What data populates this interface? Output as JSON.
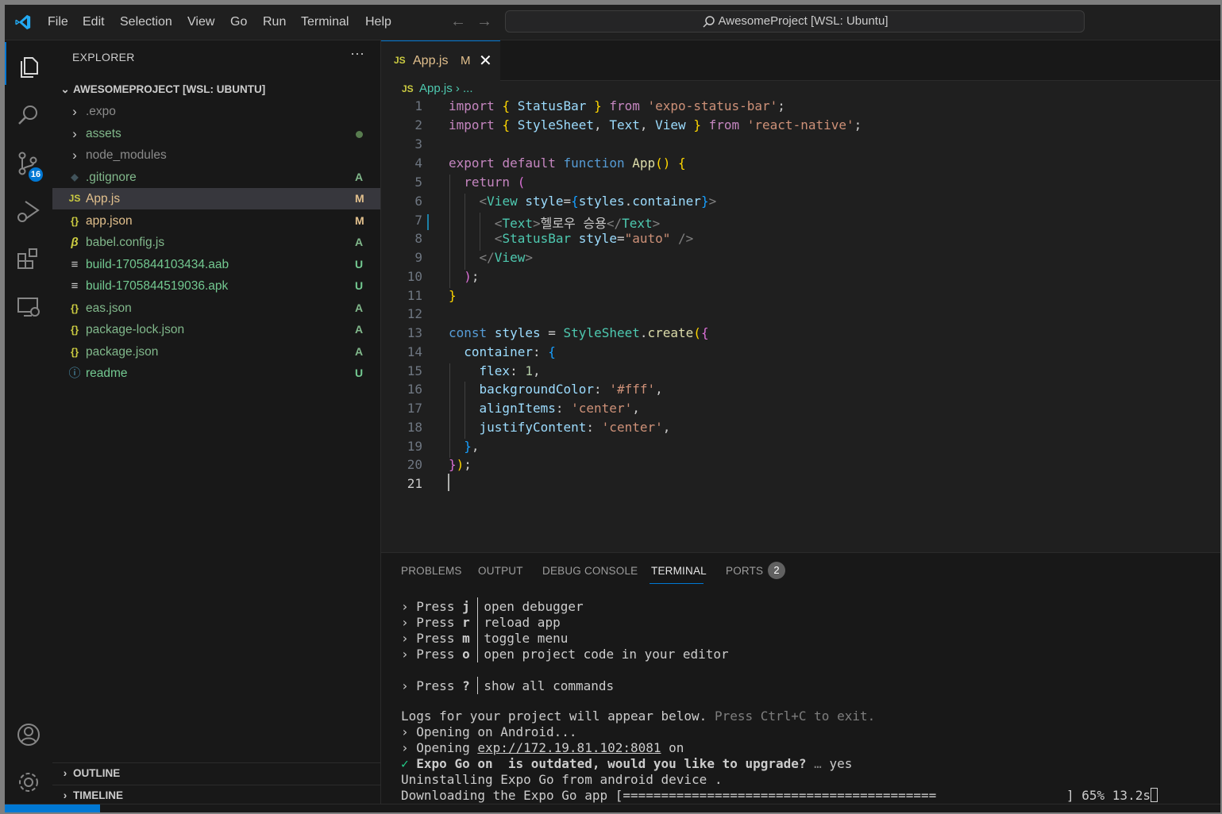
{
  "menu": [
    "File",
    "Edit",
    "Selection",
    "View",
    "Go",
    "Run",
    "Terminal",
    "Help"
  ],
  "search": {
    "text": "AwesomeProject [WSL: Ubuntu]"
  },
  "activity": {
    "scm_badge": "16"
  },
  "explorer": {
    "title": "EXPLORER",
    "more": "···",
    "project": "AWESOMEPROJECT [WSL: UBUNTU]",
    "items": [
      {
        "label": ".expo",
        "icon": "›",
        "status": ""
      },
      {
        "label": "assets",
        "icon": "›",
        "status": ""
      },
      {
        "label": "node_modules",
        "icon": "›",
        "status": ""
      },
      {
        "label": ".gitignore",
        "icon": "◆",
        "status": "A"
      },
      {
        "label": "App.js",
        "icon": "JS",
        "status": "M"
      },
      {
        "label": "app.json",
        "icon": "{}",
        "status": "M"
      },
      {
        "label": "babel.config.js",
        "icon": "β",
        "status": "A"
      },
      {
        "label": "build-1705844103434.aab",
        "icon": "≡",
        "status": "U"
      },
      {
        "label": "build-1705844519036.apk",
        "icon": "≡",
        "status": "U"
      },
      {
        "label": "eas.json",
        "icon": "{}",
        "status": "A"
      },
      {
        "label": "package-lock.json",
        "icon": "{}",
        "status": "A"
      },
      {
        "label": "package.json",
        "icon": "{}",
        "status": "A"
      },
      {
        "label": "readme",
        "icon": "ⓘ",
        "status": "U"
      }
    ],
    "outline": "OUTLINE",
    "timeline": "TIMELINE"
  },
  "editor": {
    "tab": {
      "icon": "JS",
      "name": "App.js",
      "status": "M",
      "close": "✕"
    },
    "breadcrumb": {
      "icon": "JS",
      "text": "App.js › ..."
    },
    "line_numbers": [
      "1",
      "2",
      "3",
      "4",
      "5",
      "6",
      "7",
      "8",
      "9",
      "10",
      "11",
      "12",
      "13",
      "14",
      "15",
      "16",
      "17",
      "18",
      "19",
      "20",
      "21"
    ],
    "code": {
      "l1": [
        "import",
        "{",
        "StatusBar",
        "}",
        "from",
        "'expo-status-bar'",
        ";"
      ],
      "l2": [
        "import",
        "{",
        "StyleSheet",
        ",",
        "Text",
        ",",
        "View",
        "}",
        "from",
        "'react-native'",
        ";"
      ],
      "l4": [
        "export",
        "default",
        "function",
        "App",
        "()",
        "{"
      ],
      "l5": [
        "return",
        "("
      ],
      "l6": [
        "<",
        "View",
        "style",
        "=",
        "{",
        "styles",
        ".",
        "container",
        "}",
        ">"
      ],
      "l7": [
        "<",
        "Text",
        ">",
        "헬로우 승용",
        "</",
        "Text",
        ">"
      ],
      "l8": [
        "<",
        "StatusBar",
        "style",
        "=",
        "\"auto\"",
        "/>"
      ],
      "l9": [
        "</",
        "View",
        ">"
      ],
      "l10": [
        ")",
        ";"
      ],
      "l11": [
        "}"
      ],
      "l13": [
        "const",
        "styles",
        "=",
        "StyleSheet",
        ".",
        "create",
        "(",
        "{"
      ],
      "l14": [
        "container",
        ":",
        "{"
      ],
      "l15": [
        "flex",
        ":",
        "1",
        ","
      ],
      "l16": [
        "backgroundColor",
        ":",
        "'#fff'",
        ","
      ],
      "l17": [
        "alignItems",
        ":",
        "'center'",
        ","
      ],
      "l18": [
        "justifyContent",
        ":",
        "'center'",
        ","
      ],
      "l19": [
        "}",
        ","
      ],
      "l20": [
        "}",
        ")",
        ";"
      ]
    }
  },
  "panel": {
    "tabs": [
      "PROBLEMS",
      "OUTPUT",
      "DEBUG CONSOLE",
      "TERMINAL",
      "PORTS"
    ],
    "ports_badge": "2",
    "terminal": {
      "press_rows": [
        {
          "arrow": "›",
          "press": "Press",
          "key": "j",
          "desc": "open debugger"
        },
        {
          "arrow": "›",
          "press": "Press",
          "key": "r",
          "desc": "reload app"
        },
        {
          "arrow": "›",
          "press": "Press",
          "key": "m",
          "desc": "toggle menu"
        },
        {
          "arrow": "›",
          "press": "Press",
          "key": "o",
          "desc": "open project code in your editor"
        },
        {
          "arrow": "›",
          "press": "Press",
          "key": "?",
          "desc": "show all commands"
        }
      ],
      "logs_a": "Logs for your project will appear below.",
      "logs_b": " Press Ctrl+C to exit.",
      "opening_android": "› Opening on Android...",
      "opening_prefix": "› Opening ",
      "opening_url": "exp://172.19.81.102:8081",
      "opening_suffix": " on",
      "check": "✓",
      "prompt": " Expo Go on  is outdated, would you like to upgrade?",
      "ellipsis": " …",
      "answer": " yes",
      "uninstall": "Uninstalling Expo Go from android device .",
      "download": "Downloading the Expo Go app [=========================================",
      "progress": "] 65% 13.2s"
    }
  },
  "colors": {
    "accent": "#0078d4",
    "modified": "#e2c08d",
    "added": "#81b88b",
    "untracked": "#73c991"
  }
}
